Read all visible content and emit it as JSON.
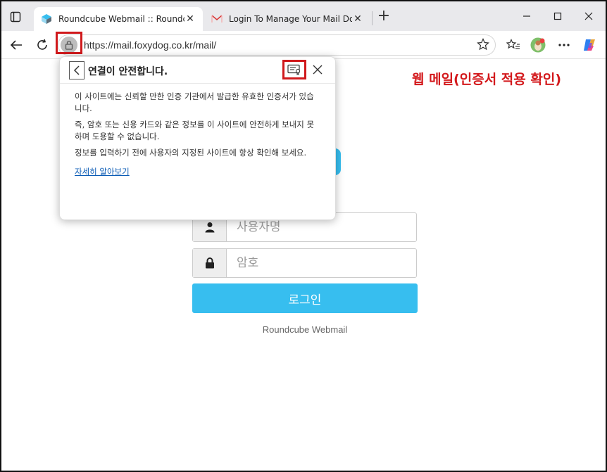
{
  "browser": {
    "tabs": [
      {
        "title": "Roundcube Webmail :: Roundcube",
        "active": true,
        "favicon": "roundcube-icon"
      },
      {
        "title": "Login To Manage Your Mail Doma",
        "active": false,
        "favicon": "mail-envelope-icon"
      }
    ],
    "close_glyph": "✕",
    "newtab_glyph": "+",
    "url": "https://mail.foxydog.co.kr/mail/"
  },
  "annotation": {
    "text": "웹 메일(인증서 적용 확인)",
    "color": "#d3191c"
  },
  "popover": {
    "title": "연결이 안전합니다.",
    "paragraphs": [
      "이 사이트에는 신뢰할 만한 인증 기관에서 발급한 유효한 인증서가 있습니다.",
      "즉, 암호 또는 신용 카드와 같은 정보를 이 사이트에 안전하게 보내지 못하며 도용할 수 없습니다.",
      "정보를 입력하기 전에 사용자의 지정된 사이트에 항상 확인해 보세요."
    ],
    "link": "자세히 알아보기"
  },
  "login": {
    "username_placeholder": "사용자명",
    "password_placeholder": "암호",
    "button": "로그인",
    "footer": "Roundcube Webmail"
  },
  "colors": {
    "accent": "#37beef",
    "highlight_box": "#d0191c"
  }
}
